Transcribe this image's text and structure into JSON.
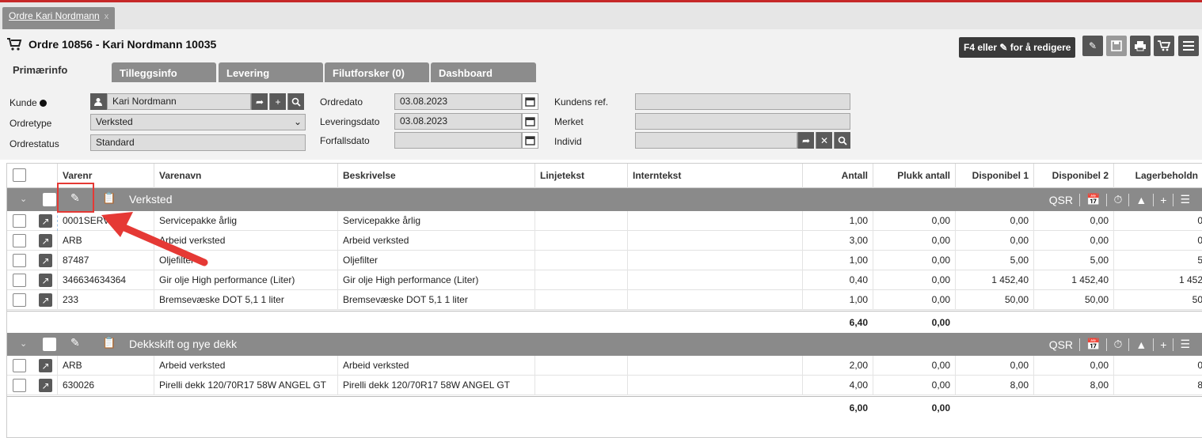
{
  "doc_tab": {
    "title": "Ordre Kari Nordmann",
    "close": "x"
  },
  "header": {
    "title": "Ordre 10856 - Kari Nordmann 10035",
    "edit_hint": "F4 eller",
    "edit_hint2": "for å redigere"
  },
  "tabs": [
    {
      "label": "Primærinfo"
    },
    {
      "label": "Tilleggsinfo"
    },
    {
      "label": "Levering"
    },
    {
      "label": "Filutforsker (0)"
    },
    {
      "label": "Dashboard"
    }
  ],
  "form": {
    "kunde_label": "Kunde",
    "kunde_value": "Kari Nordmann",
    "ordretype_label": "Ordretype",
    "ordretype_value": "Verksted",
    "ordrestatus_label": "Ordrestatus",
    "ordrestatus_value": "Standard",
    "ordredato_label": "Ordredato",
    "ordredato_value": "03.08.2023",
    "leveringsdato_label": "Leveringsdato",
    "leveringsdato_value": "03.08.2023",
    "forfallsdato_label": "Forfallsdato",
    "forfallsdato_value": "",
    "kundens_ref_label": "Kundens ref.",
    "kundens_ref_value": "",
    "merket_label": "Merket",
    "merket_value": "",
    "individ_label": "Individ",
    "individ_value": ""
  },
  "columns": [
    "Varenr",
    "Varenavn",
    "Beskrivelse",
    "Linjetekst",
    "Internteks t",
    "Antall",
    "Plukk antall",
    "Disponibel 1",
    "Disponibel 2",
    "Lagerbeholdn"
  ],
  "col_labels": {
    "varenr": "Varenr",
    "varenavn": "Varenavn",
    "beskrivelse": "Beskrivelse",
    "linjetekst": "Linjetekst",
    "interntekst": "Interntekst",
    "antall": "Antall",
    "plukk": "Plukk antall",
    "disp1": "Disponibel 1",
    "disp2": "Disponibel 2",
    "lager": "Lagerbeholdn"
  },
  "groups": [
    {
      "name": "Verksted",
      "qsr": "QSR",
      "rows": [
        {
          "varenr": "0001SERV",
          "varenavn": "Servicepakke årlig",
          "beskrivelse": "Servicepakke årlig",
          "antall": "1,00",
          "plukk": "0,00",
          "disp1": "0,00",
          "disp2": "0,00",
          "lager": "0"
        },
        {
          "varenr": "ARB",
          "varenavn": "Arbeid verksted",
          "beskrivelse": "Arbeid verksted",
          "antall": "3,00",
          "plukk": "0,00",
          "disp1": "0,00",
          "disp2": "0,00",
          "lager": "0"
        },
        {
          "varenr": "87487",
          "varenavn": "Oljefilter",
          "beskrivelse": "Oljefilter",
          "antall": "1,00",
          "plukk": "0,00",
          "disp1": "5,00",
          "disp2": "5,00",
          "lager": "5"
        },
        {
          "varenr": "346634634364",
          "varenavn": "Gir olje High performance (Liter)",
          "beskrivelse": "Gir olje High performance (Liter)",
          "antall": "0,40",
          "plukk": "0,00",
          "disp1": "1 452,40",
          "disp2": "1 452,40",
          "lager": "1 452"
        },
        {
          "varenr": "233",
          "varenavn": "Bremsevæske DOT 5,1 1 liter",
          "beskrivelse": "Bremsevæske DOT 5,1 1 liter",
          "antall": "1,00",
          "plukk": "0,00",
          "disp1": "50,00",
          "disp2": "50,00",
          "lager": "50"
        }
      ],
      "sum_antall": "6,40",
      "sum_plukk": "0,00"
    },
    {
      "name": "Dekkskift og nye dekk",
      "qsr": "QSR",
      "rows": [
        {
          "varenr": "ARB",
          "varenavn": "Arbeid verksted",
          "beskrivelse": "Arbeid verksted",
          "antall": "2,00",
          "plukk": "0,00",
          "disp1": "0,00",
          "disp2": "0,00",
          "lager": "0"
        },
        {
          "varenr": "630026",
          "varenavn": "Pirelli dekk 120/70R17 58W ANGEL GT",
          "beskrivelse": "Pirelli dekk 120/70R17 58W ANGEL GT",
          "antall": "4,00",
          "plukk": "0,00",
          "disp1": "8,00",
          "disp2": "8,00",
          "lager": "8"
        }
      ],
      "sum_antall": "6,00",
      "sum_plukk": "0,00"
    }
  ],
  "colors": {
    "accent_red": "#c62828",
    "tab_grey": "#8c8c8c",
    "group_bar": "#8a8a8a",
    "highlight": "#e53935"
  }
}
